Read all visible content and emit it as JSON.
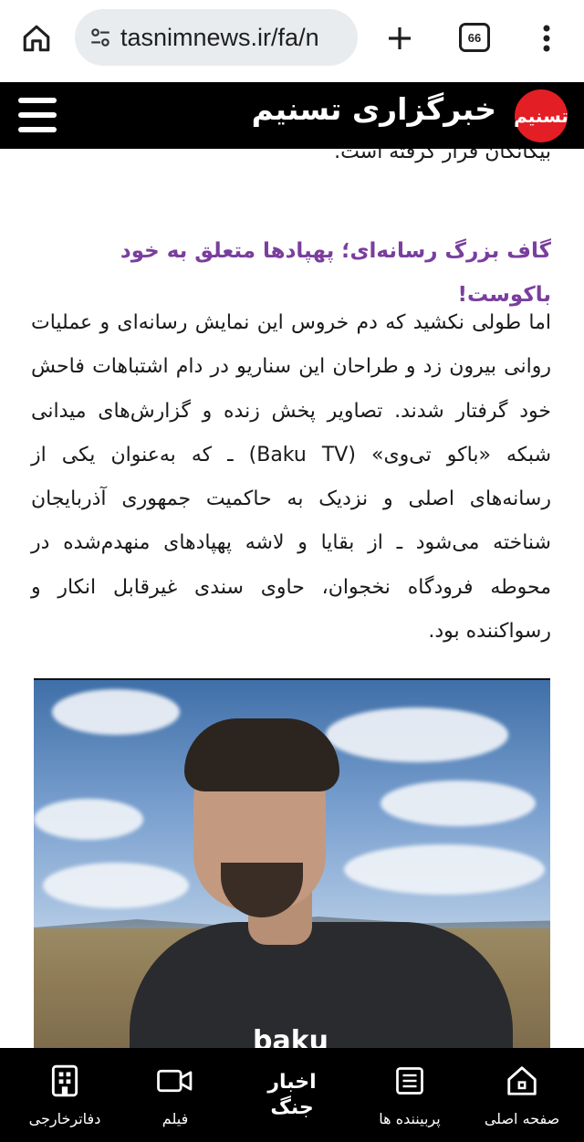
{
  "browser": {
    "url": "tasnimnews.ir/fa/n",
    "tab_count": "66"
  },
  "site": {
    "title": "خبرگزاری تسنیم",
    "logo_text": "تسنیم"
  },
  "article": {
    "para_top": "بیگانگان قرار گرفته است.",
    "subheading": "گاف بزرگ رسانه‌ای؛ پهپادها متعلق به خود باکوست!",
    "para_main": "اما طولی نکشید که دم خروس این نمایش رسانه‌ای و عملیات روانی بیرون زد و طراحان این سناریو در دام اشتباهات فاحش خود گرفتار شدند. تصاویر پخش زنده و گزارش‌های میدانی شبکه «باکو تی‌وی» (Baku TV) ـ که به‌عنوان یکی از رسانه‌های اصلی و نزدیک به حاکمیت جمهوری آذربایجان شناخته می‌شود ـ از بقایا و لاشه پهپادهای منهدم‌شده در محوطه فرودگاه نخجوان، حاوی سندی غیرقابل انکار و رسواکننده بود.",
    "video_shirt_text": "baku"
  },
  "bottom_nav": {
    "home": "صفحه اصلی",
    "dossiers": "پربیننده ها",
    "war_news_line1": "اخبار",
    "war_news_line2": "جنگ",
    "film": "فیلم",
    "foreign_offices": "دفاترخارجی"
  },
  "colors": {
    "subheading": "#7a3e9d",
    "header_bg": "#000000",
    "logo_red": "#e31e24"
  }
}
